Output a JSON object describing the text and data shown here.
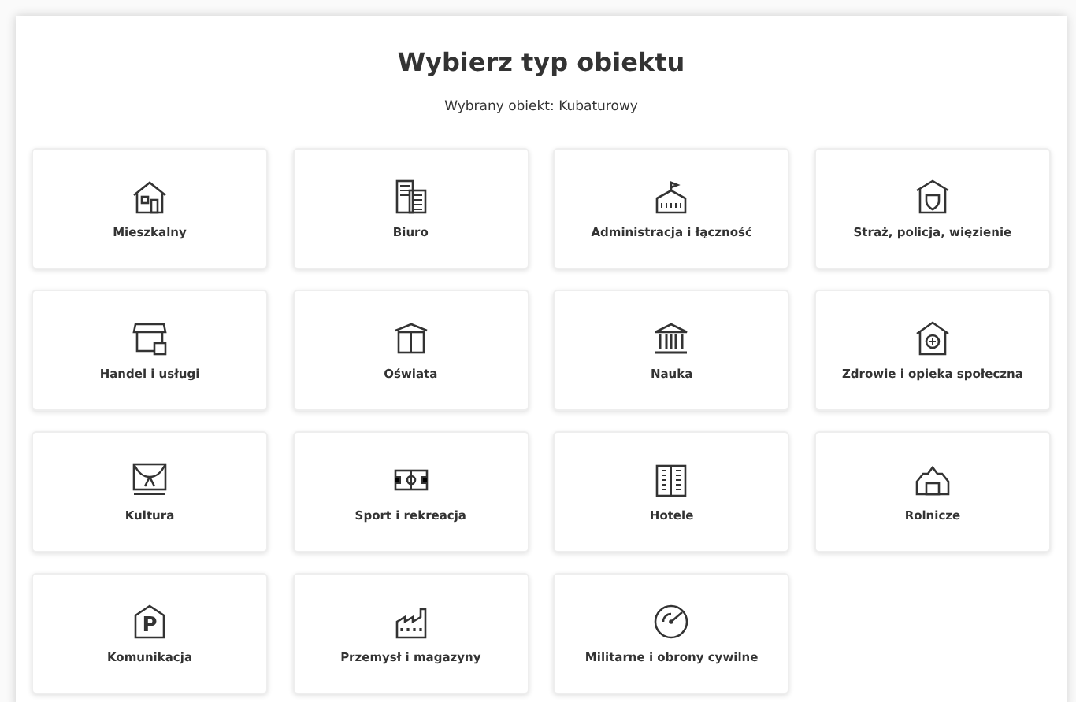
{
  "title": "Wybierz typ obiektu",
  "subtitle": "Wybrany obiekt: Kubaturowy",
  "items": [
    {
      "label": "Mieszkalny"
    },
    {
      "label": "Biuro"
    },
    {
      "label": "Administracja i łączność"
    },
    {
      "label": "Straż, policja, więzienie"
    },
    {
      "label": "Handel i usługi"
    },
    {
      "label": "Oświata"
    },
    {
      "label": "Nauka"
    },
    {
      "label": "Zdrowie i opieka społeczna"
    },
    {
      "label": "Kultura"
    },
    {
      "label": "Sport i rekreacja"
    },
    {
      "label": "Hotele"
    },
    {
      "label": "Rolnicze"
    },
    {
      "label": "Komunikacja",
      "icon_text": "P"
    },
    {
      "label": "Przemysł i magazyny"
    },
    {
      "label": "Militarne i obrony cywilne"
    }
  ]
}
